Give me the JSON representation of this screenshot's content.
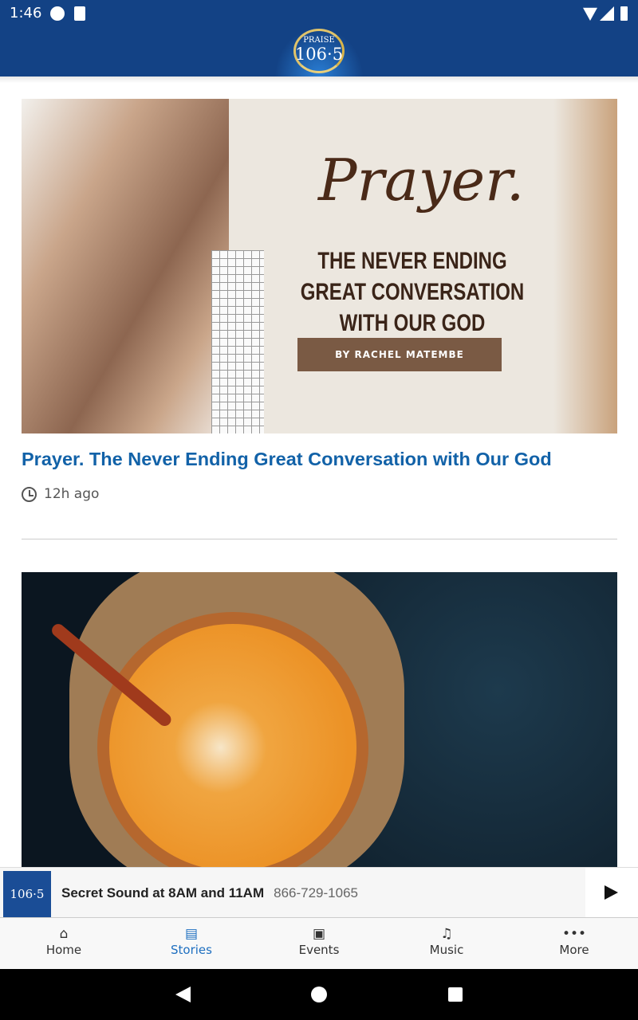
{
  "status_bar": {
    "time": "1:46"
  },
  "header": {
    "logo_top": "PRAISE",
    "logo_number": "106·5",
    "brand_color": "#134285"
  },
  "stories": [
    {
      "image": {
        "script_title": "Prayer.",
        "subtitle": "THE NEVER ENDING GREAT CONVERSATION WITH OUR GOD",
        "byline": "BY RACHEL MATEMBE"
      },
      "title": "Prayer. The Never Ending Great Conversation with Our God",
      "time": "12h ago"
    }
  ],
  "player": {
    "title": "Secret Sound at 8AM and 11AM",
    "subtitle": "866-729-1065",
    "thumb_label": "106·5"
  },
  "nav": {
    "items": [
      {
        "label": "Home",
        "icon": "home-icon"
      },
      {
        "label": "Stories",
        "icon": "stories-icon",
        "active": true
      },
      {
        "label": "Events",
        "icon": "calendar-icon"
      },
      {
        "label": "Music",
        "icon": "music-note-icon"
      },
      {
        "label": "More",
        "icon": "more-icon"
      }
    ],
    "active_color": "#1e6fc0"
  }
}
